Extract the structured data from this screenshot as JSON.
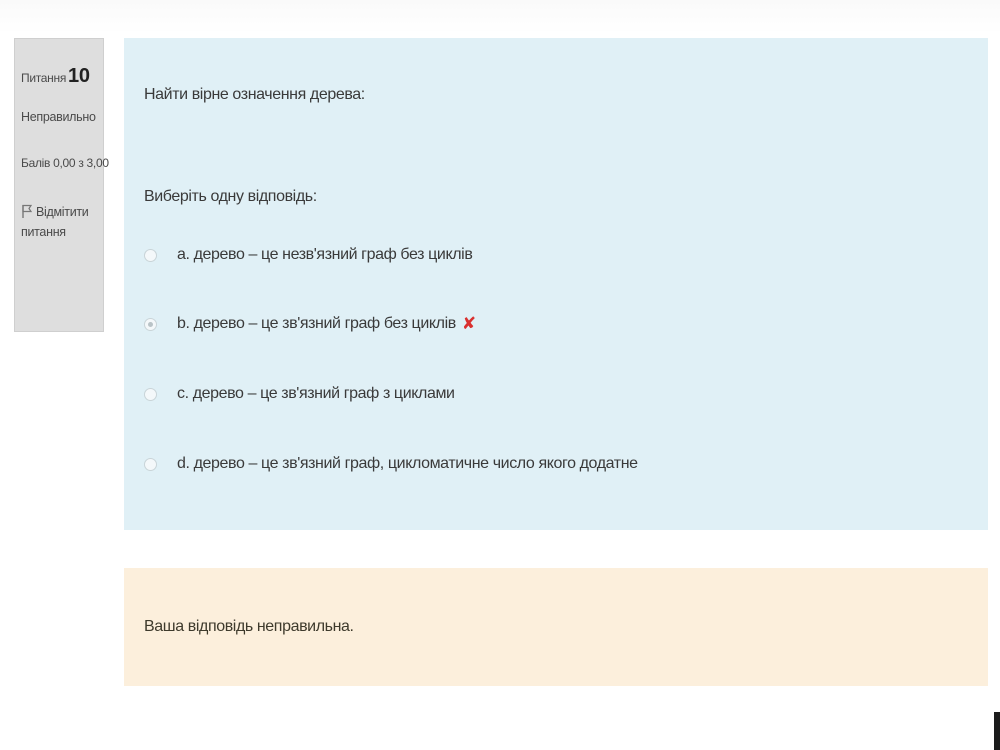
{
  "info": {
    "question_label": "Питання",
    "question_number": "10",
    "state": "Неправильно",
    "grade": "Балів 0,00 з 3,00",
    "flag_label": "Відмітити питання"
  },
  "question": {
    "text": "Найти вірне означення дерева:",
    "prompt": "Виберіть одну відповідь:",
    "answers": [
      {
        "label": "a. дерево – це незв'язний граф без циклів",
        "selected": false
      },
      {
        "label": "b. дерево – це зв'язний граф без циклів",
        "selected": true,
        "incorrect_mark": "✘"
      },
      {
        "label": "c. дерево – це зв'язний граф з циклами",
        "selected": false
      },
      {
        "label": "d. дерево – це зв'язний граф, цикломатичне число якого додатне",
        "selected": false
      }
    ]
  },
  "feedback": {
    "text": "Ваша відповідь неправильна."
  },
  "colors": {
    "info_bg": "#dedede",
    "question_bg": "#e0f0f6",
    "feedback_bg": "#fcefdc",
    "incorrect": "#d9302f"
  },
  "icons": {
    "flag": "flag-icon",
    "incorrect": "incorrect-icon"
  }
}
